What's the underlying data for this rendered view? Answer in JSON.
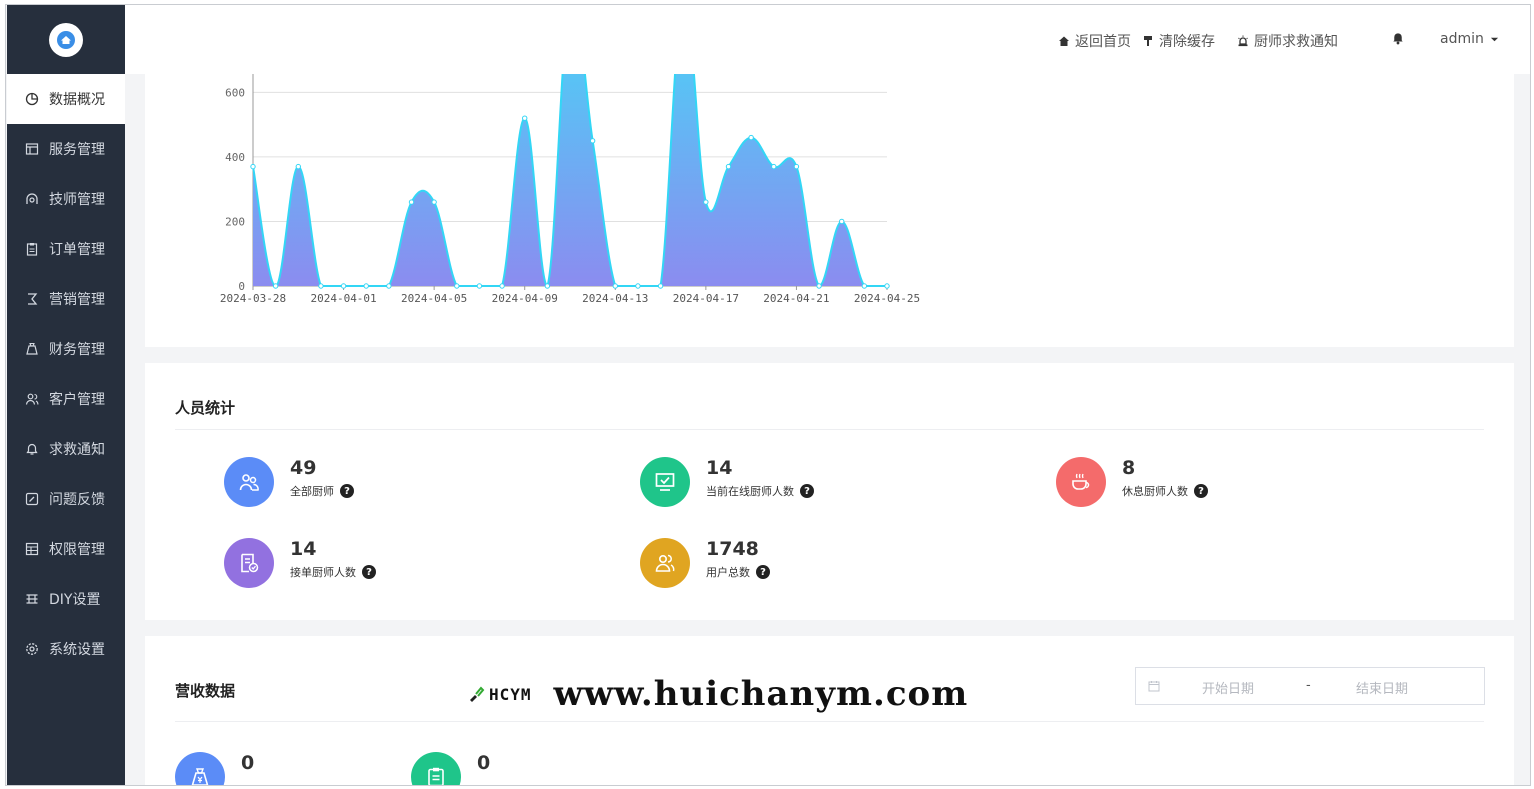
{
  "sidebar": {
    "items": [
      {
        "label": "数据概况",
        "icon": "pie-chart-icon"
      },
      {
        "label": "服务管理",
        "icon": "service-icon"
      },
      {
        "label": "技师管理",
        "icon": "technician-icon"
      },
      {
        "label": "订单管理",
        "icon": "clipboard-icon"
      },
      {
        "label": "营销管理",
        "icon": "marketing-icon"
      },
      {
        "label": "财务管理",
        "icon": "money-bag-icon"
      },
      {
        "label": "客户管理",
        "icon": "users-icon"
      },
      {
        "label": "求救通知",
        "icon": "bell-icon"
      },
      {
        "label": "问题反馈",
        "icon": "feedback-icon"
      },
      {
        "label": "权限管理",
        "icon": "permission-icon"
      },
      {
        "label": "DIY设置",
        "icon": "diy-icon"
      },
      {
        "label": "系统设置",
        "icon": "gear-icon"
      }
    ]
  },
  "header": {
    "home_label": "返回首页",
    "clear_cache_label": "清除缓存",
    "sos_label": "厨师求救通知",
    "user_label": "admin"
  },
  "chart_data": {
    "type": "area",
    "x": [
      "2024-03-28",
      "2024-03-29",
      "2024-03-30",
      "2024-03-31",
      "2024-04-01",
      "2024-04-02",
      "2024-04-03",
      "2024-04-04",
      "2024-04-05",
      "2024-04-06",
      "2024-04-07",
      "2024-04-08",
      "2024-04-09",
      "2024-04-10",
      "2024-04-11",
      "2024-04-12",
      "2024-04-13",
      "2024-04-14",
      "2024-04-15",
      "2024-04-16",
      "2024-04-17",
      "2024-04-18",
      "2024-04-19",
      "2024-04-20",
      "2024-04-21",
      "2024-04-22",
      "2024-04-23",
      "2024-04-24",
      "2024-04-25"
    ],
    "y": [
      370,
      0,
      370,
      0,
      0,
      0,
      0,
      260,
      260,
      0,
      0,
      0,
      520,
      0,
      900,
      450,
      0,
      0,
      0,
      900,
      260,
      370,
      460,
      370,
      370,
      0,
      200,
      0,
      0
    ],
    "xticks": [
      "2024-03-28",
      "2024-04-01",
      "2024-04-05",
      "2024-04-09",
      "2024-04-13",
      "2024-04-17",
      "2024-04-21",
      "2024-04-25"
    ],
    "yticks": [
      "0",
      "200",
      "400",
      "600"
    ],
    "ylim": [
      0,
      750
    ],
    "grid": true,
    "colors": {
      "line": "#33d6f5",
      "fill_top": "#44d9f7",
      "fill_bottom": "#8b8cf0"
    }
  },
  "staff": {
    "title": "人员统计",
    "items": [
      {
        "value": "49",
        "label": "全部厨师",
        "color": "#5b8cf7",
        "icon": "chefs-icon"
      },
      {
        "value": "14",
        "label": "当前在线厨师人数",
        "color": "#1fc58a",
        "icon": "monitor-check-icon"
      },
      {
        "value": "8",
        "label": "休息厨师人数",
        "color": "#f46b6b",
        "icon": "coffee-cup-icon"
      },
      {
        "value": "14",
        "label": "接单厨师人数",
        "color": "#9271e0",
        "icon": "order-accept-icon"
      },
      {
        "value": "1748",
        "label": "用户总数",
        "color": "#e0a521",
        "icon": "user-total-icon"
      }
    ]
  },
  "revenue": {
    "title": "营收数据",
    "start_placeholder": "开始日期",
    "end_placeholder": "结束日期",
    "separator": "-",
    "items": [
      {
        "value": "0",
        "color": "#5b8cf7",
        "icon": "money-bag-icon"
      },
      {
        "value": "0",
        "color": "#1fc58a",
        "icon": "clipboard-icon"
      }
    ]
  },
  "watermark": {
    "logo_text": "HCYM",
    "url": "www.huichanym.com"
  }
}
